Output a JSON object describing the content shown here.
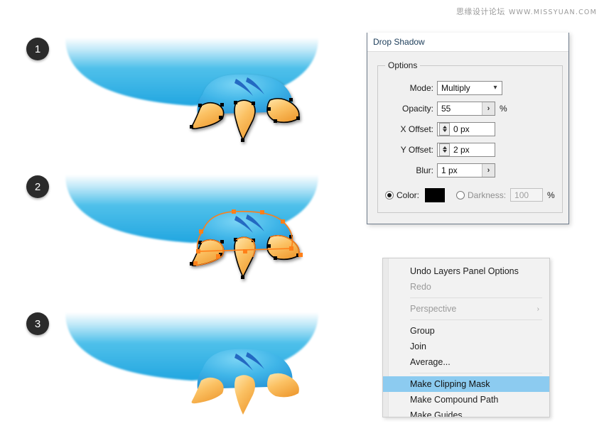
{
  "watermark": {
    "text": "思缘设计论坛",
    "url": "WWW.MISSYUAN.COM"
  },
  "steps": [
    {
      "number": "1"
    },
    {
      "number": "2"
    },
    {
      "number": "3"
    }
  ],
  "dialog": {
    "title": "Drop Shadow",
    "options_legend": "Options",
    "mode": {
      "label": "Mode:",
      "value": "Multiply",
      "chevron": "chevron-down-icon"
    },
    "opacity": {
      "label": "Opacity:",
      "value": "55",
      "unit": "%",
      "flyout": "›"
    },
    "x_offset": {
      "label": "X Offset:",
      "value": "0 px"
    },
    "y_offset": {
      "label": "Y Offset:",
      "value": "2 px"
    },
    "blur": {
      "label": "Blur:",
      "value": "1 px",
      "flyout": "›"
    },
    "color": {
      "label": "Color:",
      "selected": true,
      "swatch_hex": "#000000"
    },
    "darkness": {
      "label": "Darkness:",
      "selected": false,
      "value": "100",
      "unit": "%"
    }
  },
  "context_menu": {
    "items": [
      {
        "label": "Undo Layers Panel Options",
        "state": "normal",
        "separator_after": false
      },
      {
        "label": "Redo",
        "state": "disabled",
        "separator_after": true
      },
      {
        "label": "Perspective",
        "state": "disabled",
        "submenu": "›",
        "separator_after": true
      },
      {
        "label": "Group",
        "state": "normal",
        "separator_after": false
      },
      {
        "label": "Join",
        "state": "normal",
        "separator_after": false
      },
      {
        "label": "Average...",
        "state": "normal",
        "separator_after": true
      },
      {
        "label": "Make Clipping Mask",
        "state": "selected",
        "separator_after": false
      },
      {
        "label": "Make Compound Path",
        "state": "normal",
        "separator_after": false
      },
      {
        "label": "Make Guides",
        "state": "normal",
        "separator_after": false
      }
    ]
  },
  "artwork": {
    "blob_color_top": "#ffffff",
    "blob_color_bottom": "#29abe2",
    "body_color_light": "#55c7ef",
    "body_color_deep": "#1a72c8",
    "claw_color_light": "#ffd98a",
    "claw_color_deep": "#f0a03c",
    "anchor_color": "#ff7f18",
    "outline_color": "#000000"
  }
}
